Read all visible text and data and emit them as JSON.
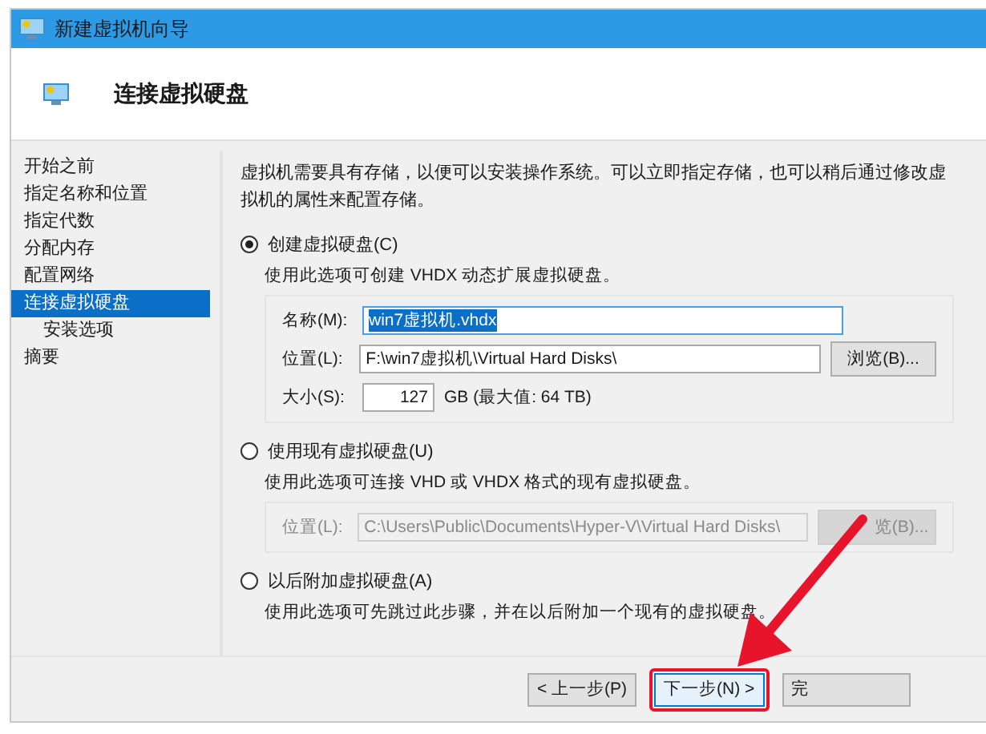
{
  "window": {
    "title": "新建虚拟机向导"
  },
  "header": {
    "title": "连接虚拟硬盘"
  },
  "nav": [
    {
      "label": "开始之前",
      "selected": false
    },
    {
      "label": "指定名称和位置",
      "selected": false
    },
    {
      "label": "指定代数",
      "selected": false
    },
    {
      "label": "分配内存",
      "selected": false
    },
    {
      "label": "配置网络",
      "selected": false
    },
    {
      "label": "连接虚拟硬盘",
      "selected": true,
      "children": [
        {
          "label": "安装选项",
          "selected": false
        }
      ]
    },
    {
      "label": "摘要",
      "selected": false
    }
  ],
  "intro": "虚拟机需要具有存储，以便可以安装操作系统。可以立即指定存储，也可以稍后通过修改虚拟机的属性来配置存储。",
  "options": [
    {
      "label": "创建虚拟硬盘(C)",
      "selected": true,
      "description": "使用此选项可创建 VHDX 动态扩展虚拟硬盘。",
      "fields": [
        {
          "kind": "text",
          "label": "名称(M):",
          "value": "win7虚拟机.vhdx",
          "text_selected": true,
          "disabled": false
        },
        {
          "kind": "path",
          "label": "位置(L):",
          "value": "F:\\win7虚拟机\\Virtual Hard Disks\\",
          "button": "浏览(B)...",
          "disabled": false
        },
        {
          "kind": "number",
          "label": "大小(S):",
          "value": "127",
          "unit": "GB (最大值: 64 TB)",
          "disabled": false
        }
      ]
    },
    {
      "label": "使用现有虚拟硬盘(U)",
      "selected": false,
      "description": "使用此选项可连接 VHD 或 VHDX 格式的现有虚拟硬盘。",
      "fields": [
        {
          "kind": "path",
          "label": "位置(L):",
          "value": "C:\\Users\\Public\\Documents\\Hyper-V\\Virtual Hard Disks\\",
          "button": "览(B)...",
          "disabled": true
        }
      ]
    },
    {
      "label": "以后附加虚拟硬盘(A)",
      "selected": false,
      "description": "使用此选项可先跳过此步骤，并在以后附加一个现有的虚拟硬盘。"
    }
  ],
  "buttons": [
    {
      "label": "< 上一步(P)",
      "focused": false,
      "highlighted": false
    },
    {
      "label": "下一步(N) >",
      "focused": true,
      "highlighted": true
    },
    {
      "label": "完",
      "focused": false,
      "highlighted": false
    }
  ]
}
